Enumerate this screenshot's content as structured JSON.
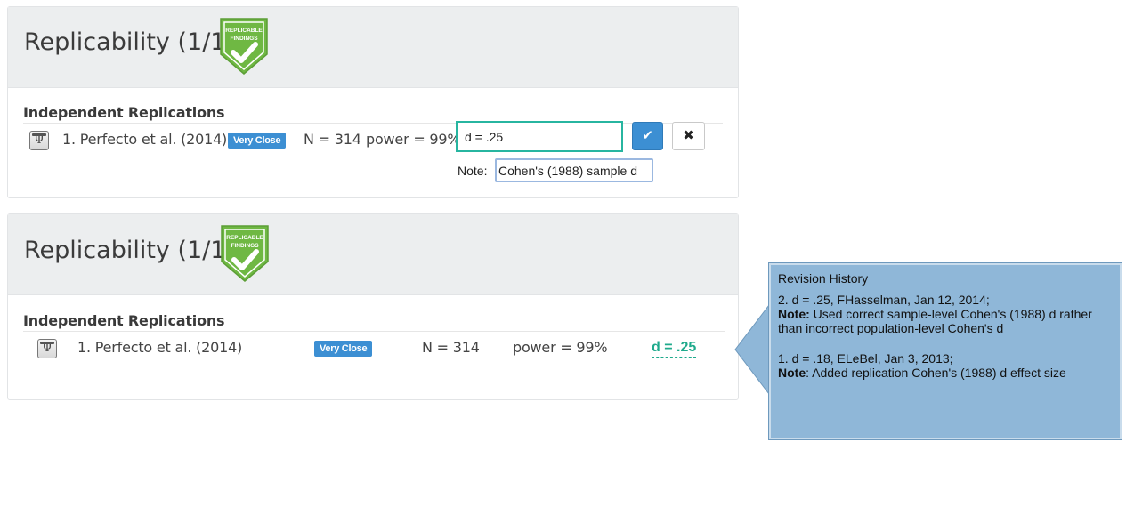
{
  "badge_text": "REPLICABLE FINDINGS",
  "colors": {
    "accent_blue": "#3c8fd3",
    "accent_green": "#1faa8c",
    "badge_green": "#6fb843",
    "popover_bg": "#8fb7d8"
  },
  "panel_top": {
    "title": "Replicability (1/1)",
    "section_label": "Independent Replications",
    "row": {
      "study": "1. Perfecto et al. (2014)",
      "tag": "Very Close",
      "n": "N = 314",
      "power": "power = 99%"
    },
    "edit": {
      "value": "d = .25",
      "note_label": "Note:",
      "note_value": "Cohen's (1988) sample d",
      "save_icon": "check-icon",
      "cancel_icon": "close-icon"
    }
  },
  "panel_bottom": {
    "title": "Replicability (1/1)",
    "section_label": "Independent Replications",
    "row": {
      "study": "1. Perfecto et al. (2014)",
      "tag": "Very Close",
      "n": "N = 314",
      "power": "power = 99%",
      "effect": "d = .25"
    }
  },
  "revision_history": {
    "title": "Revision History",
    "entries": [
      {
        "header": "2. d = .25, FHasselman, Jan 12, 2014;",
        "note_label": "Note:",
        "note_text": " Used correct sample-level Cohen's (1988) d rather than incorrect population-level Cohen's d"
      },
      {
        "header": "1. d = .18, ELeBel, Jan 3, 2013;",
        "note_label": "Note",
        "note_text": ": Added replication Cohen's (1988) d effect size"
      }
    ]
  }
}
